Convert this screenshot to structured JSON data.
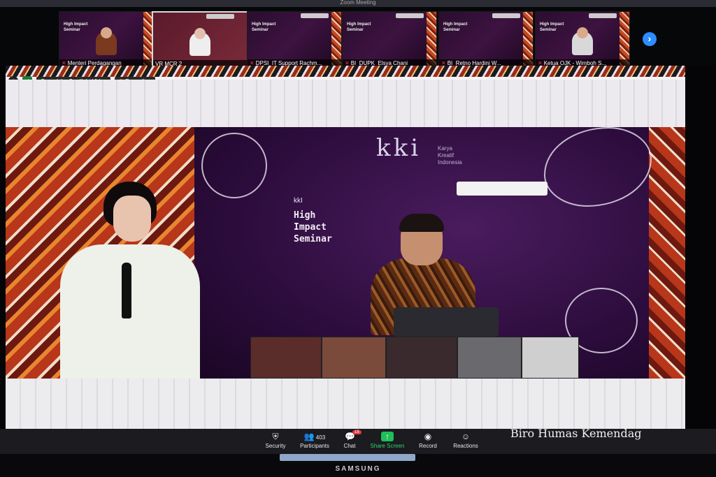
{
  "window": {
    "title": "Zoom Meeting"
  },
  "participants_strip": {
    "tiles": [
      {
        "name": "Menteri Perdagangan",
        "muted": true,
        "seminar": "High Impact Seminar"
      },
      {
        "name": "VR MCR 2",
        "muted": false,
        "active": true,
        "seminar": ""
      },
      {
        "name": "DPSI_IT Support Rachm...",
        "muted": true,
        "seminar": "High Impact Seminar"
      },
      {
        "name": "BI_DUPK_Elsya Chani",
        "muted": true,
        "seminar": "High Impact Seminar"
      },
      {
        "name": "BI_Retno Hardini W...",
        "muted": true,
        "seminar": "High Impact Seminar"
      },
      {
        "name": "Ketua OJK - Wimboh S...",
        "muted": true,
        "seminar": "High Impact Seminar"
      }
    ],
    "next_icon": "chevron-right-icon"
  },
  "spotlight_bar": {
    "info_icon": "info-icon",
    "security_icon": "shield-icon",
    "cancel_label": "Cancel the Spotlight Video",
    "recording_label": "Recording"
  },
  "stage": {
    "brand_logo": "kki",
    "brand_sub": "Karya\nKreatif\nIndonesia",
    "event_logo": "kkI",
    "event_title": "High\nImpact\nSeminar"
  },
  "toolbar": {
    "items": [
      {
        "label": "Security",
        "icon": "shield-icon"
      },
      {
        "label": "Participants",
        "icon": "participants-icon",
        "count": "403"
      },
      {
        "label": "Chat",
        "icon": "chat-icon",
        "badge": "15"
      },
      {
        "label": "Share Screen",
        "icon": "share-screen-icon"
      },
      {
        "label": "Record",
        "icon": "record-icon"
      },
      {
        "label": "Reactions",
        "icon": "reactions-icon"
      }
    ]
  },
  "watermark": "Biro Humas Kemendag",
  "monitor_brand": "SAMSUNG",
  "colors": {
    "share_green": "#1fbf5a",
    "record_red": "#e23b3b",
    "accent_blue": "#2d8cff"
  }
}
